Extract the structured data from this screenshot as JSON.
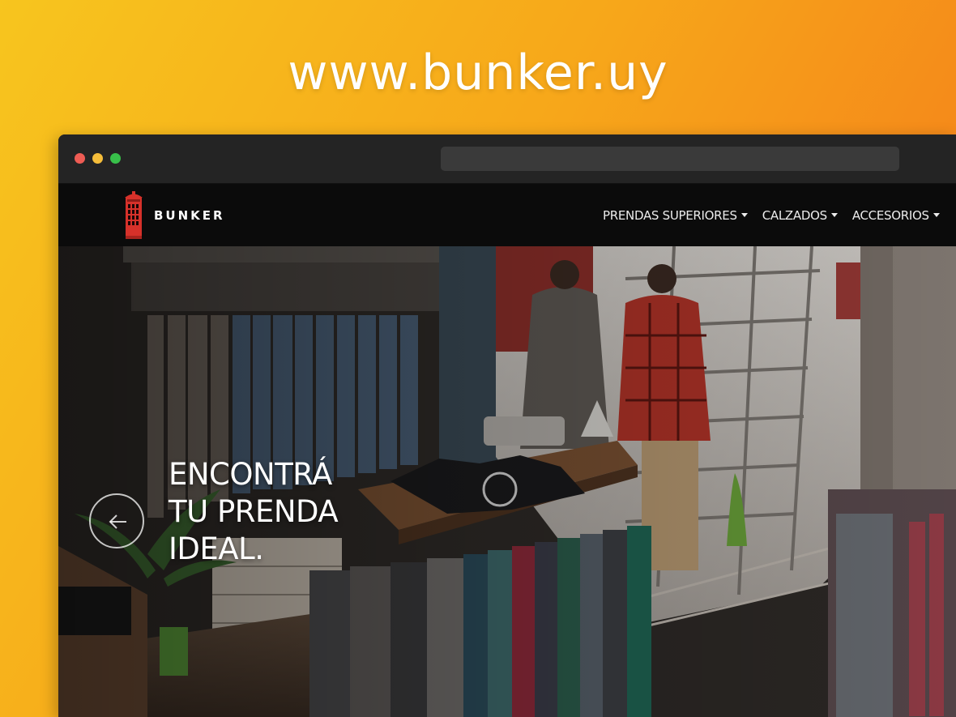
{
  "promo": {
    "site_url": "www.bunker.uy"
  },
  "browser": {
    "window_controls": [
      "close",
      "minimize",
      "maximize"
    ]
  },
  "site": {
    "brand": "BUNKER",
    "logo_icon": "phone-booth-icon",
    "nav": {
      "items": [
        {
          "label": "PRENDAS SUPERIORES"
        },
        {
          "label": "CALZADOS"
        },
        {
          "label": "ACCESORIOS"
        }
      ]
    },
    "hero": {
      "headline_lines": [
        "ENCONTRÁ",
        "TU PRENDA",
        "IDEAL."
      ],
      "prev_icon": "arrow-left-icon"
    }
  },
  "colors": {
    "background_gradient_start": "#f7c51e",
    "background_gradient_end": "#f3731a",
    "navbar": "#0b0b0b",
    "brand_red": "#d6312a"
  }
}
